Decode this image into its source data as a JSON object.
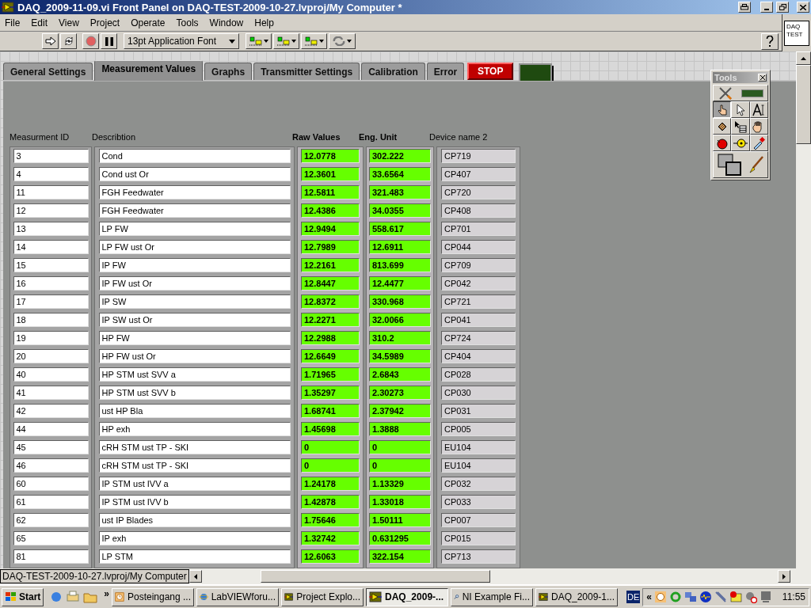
{
  "window": {
    "title": "DAQ_2009-11-09.vi Front Panel on DAQ-TEST-2009-10-27.lvproj/My Computer *"
  },
  "menu": [
    "File",
    "Edit",
    "View",
    "Project",
    "Operate",
    "Tools",
    "Window",
    "Help"
  ],
  "toolbar": {
    "font": "13pt Application Font"
  },
  "vi_icon": [
    "DAQ",
    "TEST"
  ],
  "tabs": [
    {
      "label": "General Settings",
      "selected": false
    },
    {
      "label": "Measurement Values",
      "selected": true
    },
    {
      "label": "Graphs",
      "selected": false
    },
    {
      "label": "Transmitter Settings",
      "selected": false
    },
    {
      "label": "Calibration",
      "selected": false
    },
    {
      "label": "Error",
      "selected": false
    }
  ],
  "stop_button": "STOP",
  "led": {
    "on": false
  },
  "table": {
    "columns": [
      "Measurment ID",
      "Describtion",
      "Raw Values",
      "Eng. Unit",
      "Device name 2"
    ],
    "rows": [
      {
        "id": "3",
        "description": "Cond",
        "raw": "12.0778",
        "eng": "302.222",
        "device": "CP719"
      },
      {
        "id": "4",
        "description": "Cond ust Or",
        "raw": "12.3601",
        "eng": "33.6564",
        "device": "CP407"
      },
      {
        "id": "11",
        "description": "FGH Feedwater",
        "raw": "12.5811",
        "eng": "321.483",
        "device": "CP720"
      },
      {
        "id": "12",
        "description": "FGH Feedwater",
        "raw": "12.4386",
        "eng": "34.0355",
        "device": "CP408"
      },
      {
        "id": "13",
        "description": "LP FW",
        "raw": "12.9494",
        "eng": "558.617",
        "device": "CP701"
      },
      {
        "id": "14",
        "description": "LP FW ust Or",
        "raw": "12.7989",
        "eng": "12.6911",
        "device": "CP044"
      },
      {
        "id": "15",
        "description": "IP FW",
        "raw": "12.2161",
        "eng": "813.699",
        "device": "CP709"
      },
      {
        "id": "16",
        "description": "IP FW ust Or",
        "raw": "12.8447",
        "eng": "12.4477",
        "device": "CP042"
      },
      {
        "id": "17",
        "description": "IP SW",
        "raw": "12.8372",
        "eng": "330.968",
        "device": "CP721"
      },
      {
        "id": "18",
        "description": "IP SW ust Or",
        "raw": "12.2271",
        "eng": "32.0066",
        "device": "CP041"
      },
      {
        "id": "19",
        "description": "HP FW",
        "raw": "12.2988",
        "eng": "310.2",
        "device": "CP724"
      },
      {
        "id": "20",
        "description": "HP FW ust Or",
        "raw": "12.6649",
        "eng": "34.5989",
        "device": "CP404"
      },
      {
        "id": "40",
        "description": "HP STM ust SVV a",
        "raw": "1.71965",
        "eng": "2.6843",
        "device": "CP028"
      },
      {
        "id": "41",
        "description": "HP STM ust SVV b",
        "raw": "1.35297",
        "eng": "2.30273",
        "device": "CP030"
      },
      {
        "id": "42",
        "description": "ust HP Bla",
        "raw": "1.68741",
        "eng": "2.37942",
        "device": "CP031"
      },
      {
        "id": "44",
        "description": "HP exh",
        "raw": "1.45698",
        "eng": "1.3888",
        "device": "CP005"
      },
      {
        "id": "45",
        "description": "cRH STM ust TP - SKI",
        "raw": "0",
        "eng": "0",
        "device": "EU104"
      },
      {
        "id": "46",
        "description": "cRH STM ust TP - SKI",
        "raw": "0",
        "eng": "0",
        "device": "EU104"
      },
      {
        "id": "60",
        "description": "IP STM ust IVV a",
        "raw": "1.24178",
        "eng": "1.13329",
        "device": "CP032"
      },
      {
        "id": "61",
        "description": "IP STM ust IVV b",
        "raw": "1.42878",
        "eng": "1.33018",
        "device": "CP033"
      },
      {
        "id": "62",
        "description": "ust IP Blades",
        "raw": "1.75646",
        "eng": "1.50111",
        "device": "CP007"
      },
      {
        "id": "65",
        "description": "IP exh",
        "raw": "1.32742",
        "eng": "0.631295",
        "device": "CP015"
      },
      {
        "id": "81",
        "description": "LP STM",
        "raw": "12.6063",
        "eng": "322.154",
        "device": "CP713"
      }
    ]
  },
  "tools_palette": {
    "title": "Tools",
    "tools": [
      {
        "kind": "operate",
        "selected": true
      },
      {
        "kind": "position",
        "selected": false
      },
      {
        "kind": "text",
        "selected": false
      },
      {
        "kind": "wire",
        "selected": false
      },
      {
        "kind": "shortcut",
        "selected": false
      },
      {
        "kind": "scroll",
        "selected": false
      },
      {
        "kind": "breakpoint",
        "selected": false
      },
      {
        "kind": "probe",
        "selected": false
      },
      {
        "kind": "color-copy",
        "selected": false
      }
    ]
  },
  "status_bar": {
    "path": "DAQ-TEST-2009-10-27.lvproj/My Computer"
  },
  "taskbar": {
    "start": "Start",
    "chevron": "»",
    "tasks": [
      {
        "label": "Posteingang ...",
        "kind": "mail",
        "selected": false
      },
      {
        "label": "LabVIEWforu...",
        "kind": "browser",
        "selected": false
      },
      {
        "label": "Project Explo...",
        "kind": "labview",
        "selected": false
      },
      {
        "label": "DAQ_2009-...",
        "kind": "labview",
        "selected": true
      },
      {
        "label": "NI Example Fi...",
        "kind": "finder",
        "selected": false
      },
      {
        "label": "DAQ_2009-1...",
        "kind": "labview",
        "selected": false
      }
    ],
    "language": "DE",
    "tray_chevron": "«",
    "clock": "11:55"
  }
}
